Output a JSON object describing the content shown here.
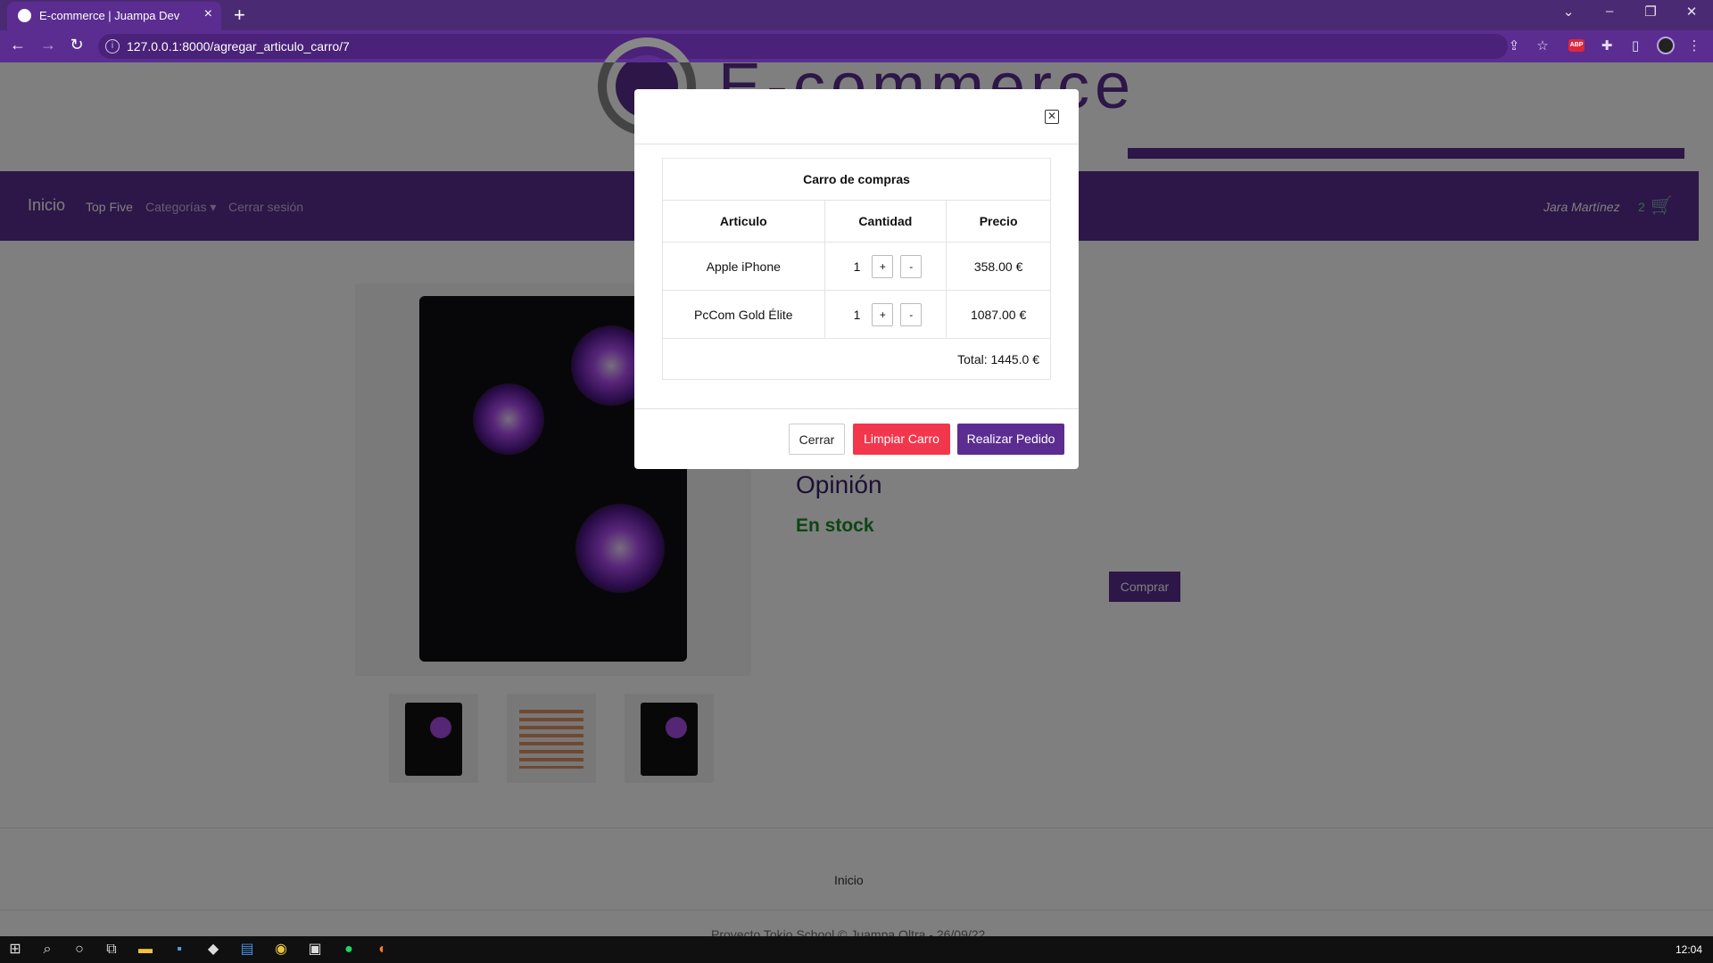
{
  "browser": {
    "tab_title": "E-commerce | Juampa Dev",
    "url": "127.0.0.1:8000/agregar_articulo_carro/7",
    "abp_label": "ABP"
  },
  "site": {
    "logo_text": "E-commerce",
    "nav": {
      "inicio": "Inicio",
      "top_five": "Top Five",
      "categorias": "Categorías ▾",
      "cerrar_sesion": "Cerrar sesión",
      "user": "Jara Martínez",
      "cart_count": "2"
    },
    "product": {
      "opinion": "Opinión",
      "stock": "En stock",
      "comprar": "Comprar"
    },
    "footer": {
      "inicio": "Inicio",
      "copyright": "Proyecto Tokio School © Juampa Oltra - 26/09/22"
    }
  },
  "modal": {
    "caption": "Carro de compras",
    "headers": [
      "Articulo",
      "Cantidad",
      "Precio"
    ],
    "items": [
      {
        "name": "Apple iPhone",
        "qty": "1",
        "price": "358.00 €"
      },
      {
        "name": "PcCom Gold Élite",
        "qty": "1",
        "price": "1087.00 €"
      }
    ],
    "plus": "+",
    "minus": "-",
    "total": "Total: 1445.0 €",
    "buttons": {
      "cerrar": "Cerrar",
      "limpiar": "Limpiar Carro",
      "pedido": "Realizar Pedido"
    }
  },
  "taskbar": {
    "clock": "12:04"
  },
  "colors": {
    "brand": "#5b2d91",
    "danger": "#f2374c",
    "stock": "#1a8a2a"
  }
}
